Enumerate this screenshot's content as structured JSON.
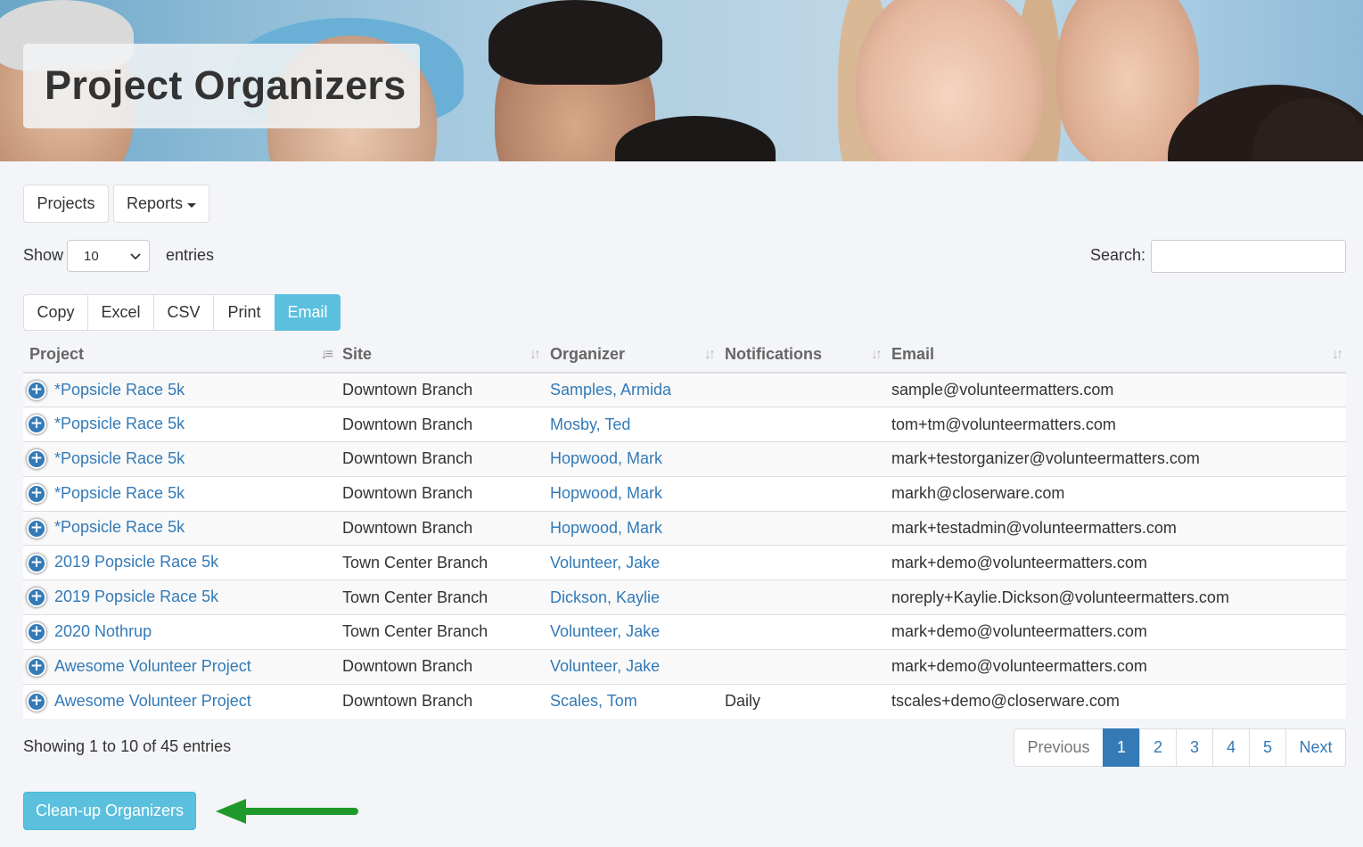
{
  "banner": {
    "title": "Project Organizers"
  },
  "nav": {
    "projects": "Projects",
    "reports": "Reports"
  },
  "length": {
    "show": "Show",
    "value": "10",
    "entries": "entries"
  },
  "search": {
    "label": "Search:",
    "value": ""
  },
  "export": {
    "copy": "Copy",
    "excel": "Excel",
    "csv": "CSV",
    "print": "Print",
    "email": "Email"
  },
  "table": {
    "headers": {
      "project": "Project",
      "site": "Site",
      "organizer": "Organizer",
      "notifications": "Notifications",
      "email": "Email"
    },
    "rows": [
      {
        "project": "*Popsicle Race 5k",
        "site": "Downtown Branch",
        "organizer": "Samples, Armida",
        "notifications": "",
        "email": "sample@volunteermatters.com"
      },
      {
        "project": "*Popsicle Race 5k",
        "site": "Downtown Branch",
        "organizer": "Mosby, Ted",
        "notifications": "",
        "email": "tom+tm@volunteermatters.com"
      },
      {
        "project": "*Popsicle Race 5k",
        "site": "Downtown Branch",
        "organizer": "Hopwood, Mark",
        "notifications": "",
        "email": "mark+testorganizer@volunteermatters.com"
      },
      {
        "project": "*Popsicle Race 5k",
        "site": "Downtown Branch",
        "organizer": "Hopwood, Mark",
        "notifications": "",
        "email": "markh@closerware.com"
      },
      {
        "project": "*Popsicle Race 5k",
        "site": "Downtown Branch",
        "organizer": "Hopwood, Mark",
        "notifications": "",
        "email": "mark+testadmin@volunteermatters.com"
      },
      {
        "project": "2019 Popsicle Race 5k",
        "site": "Town Center Branch",
        "organizer": "Volunteer, Jake",
        "notifications": "",
        "email": "mark+demo@volunteermatters.com"
      },
      {
        "project": "2019 Popsicle Race 5k",
        "site": "Town Center Branch",
        "organizer": "Dickson, Kaylie",
        "notifications": "",
        "email": "noreply+Kaylie.Dickson@volunteermatters.com"
      },
      {
        "project": "2020 Nothrup",
        "site": "Town Center Branch",
        "organizer": "Volunteer, Jake",
        "notifications": "",
        "email": "mark+demo@volunteermatters.com"
      },
      {
        "project": "Awesome Volunteer Project",
        "site": "Downtown Branch",
        "organizer": "Volunteer, Jake",
        "notifications": "",
        "email": "mark+demo@volunteermatters.com"
      },
      {
        "project": "Awesome Volunteer Project",
        "site": "Downtown Branch",
        "organizer": "Scales, Tom",
        "notifications": "Daily",
        "email": "tscales+demo@closerware.com"
      }
    ]
  },
  "info": "Showing 1 to 10 of 45 entries",
  "pager": {
    "previous": "Previous",
    "pages": [
      "1",
      "2",
      "3",
      "4",
      "5"
    ],
    "next": "Next",
    "current": "1"
  },
  "cleanup": "Clean-up Organizers",
  "colors": {
    "accent": "#5bc0de",
    "link": "#337ab7",
    "arrow": "#1f9a2a"
  }
}
